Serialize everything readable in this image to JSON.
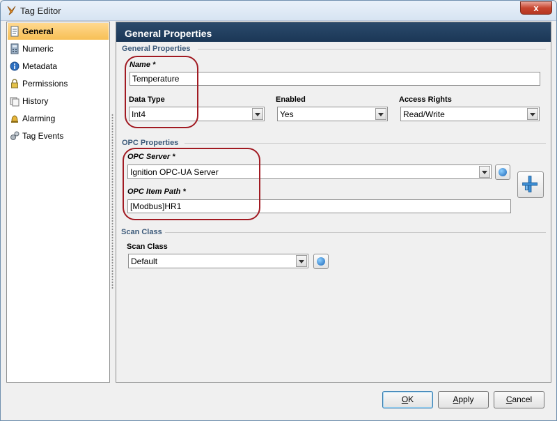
{
  "window": {
    "title": "Tag Editor",
    "close_glyph": "x"
  },
  "sidebar": {
    "items": [
      {
        "label": "General",
        "icon": "document-icon"
      },
      {
        "label": "Numeric",
        "icon": "calculator-icon"
      },
      {
        "label": "Metadata",
        "icon": "info-icon"
      },
      {
        "label": "Permissions",
        "icon": "lock-icon"
      },
      {
        "label": "History",
        "icon": "history-icon"
      },
      {
        "label": "Alarming",
        "icon": "bell-icon"
      },
      {
        "label": "Tag Events",
        "icon": "gears-icon"
      }
    ],
    "active_index": 0
  },
  "main": {
    "header": "General Properties",
    "general": {
      "section_title": "General Properties",
      "name_label": "Name *",
      "name_value": "Temperature",
      "data_type_label": "Data Type",
      "data_type_value": "Int4",
      "enabled_label": "Enabled",
      "enabled_value": "Yes",
      "access_label": "Access Rights",
      "access_value": "Read/Write"
    },
    "opc": {
      "section_title": "OPC Properties",
      "server_label": "OPC Server *",
      "server_value": "Ignition OPC-UA Server",
      "item_path_label": "OPC Item Path *",
      "item_path_value": "[Modbus]HR1"
    },
    "scan": {
      "section_title": "Scan Class",
      "label": "Scan Class",
      "value": "Default"
    }
  },
  "buttons": {
    "ok_mnemonic": "O",
    "ok_rest": "K",
    "apply_mnemonic": "A",
    "apply_rest": "pply",
    "cancel_mnemonic": "C",
    "cancel_rest": "ancel"
  },
  "colors": {
    "header_bg": "#1e3a5a",
    "active_item_bg": "#f9c766",
    "annotation": "#a11a22",
    "section_title": "#3c5a7a"
  }
}
